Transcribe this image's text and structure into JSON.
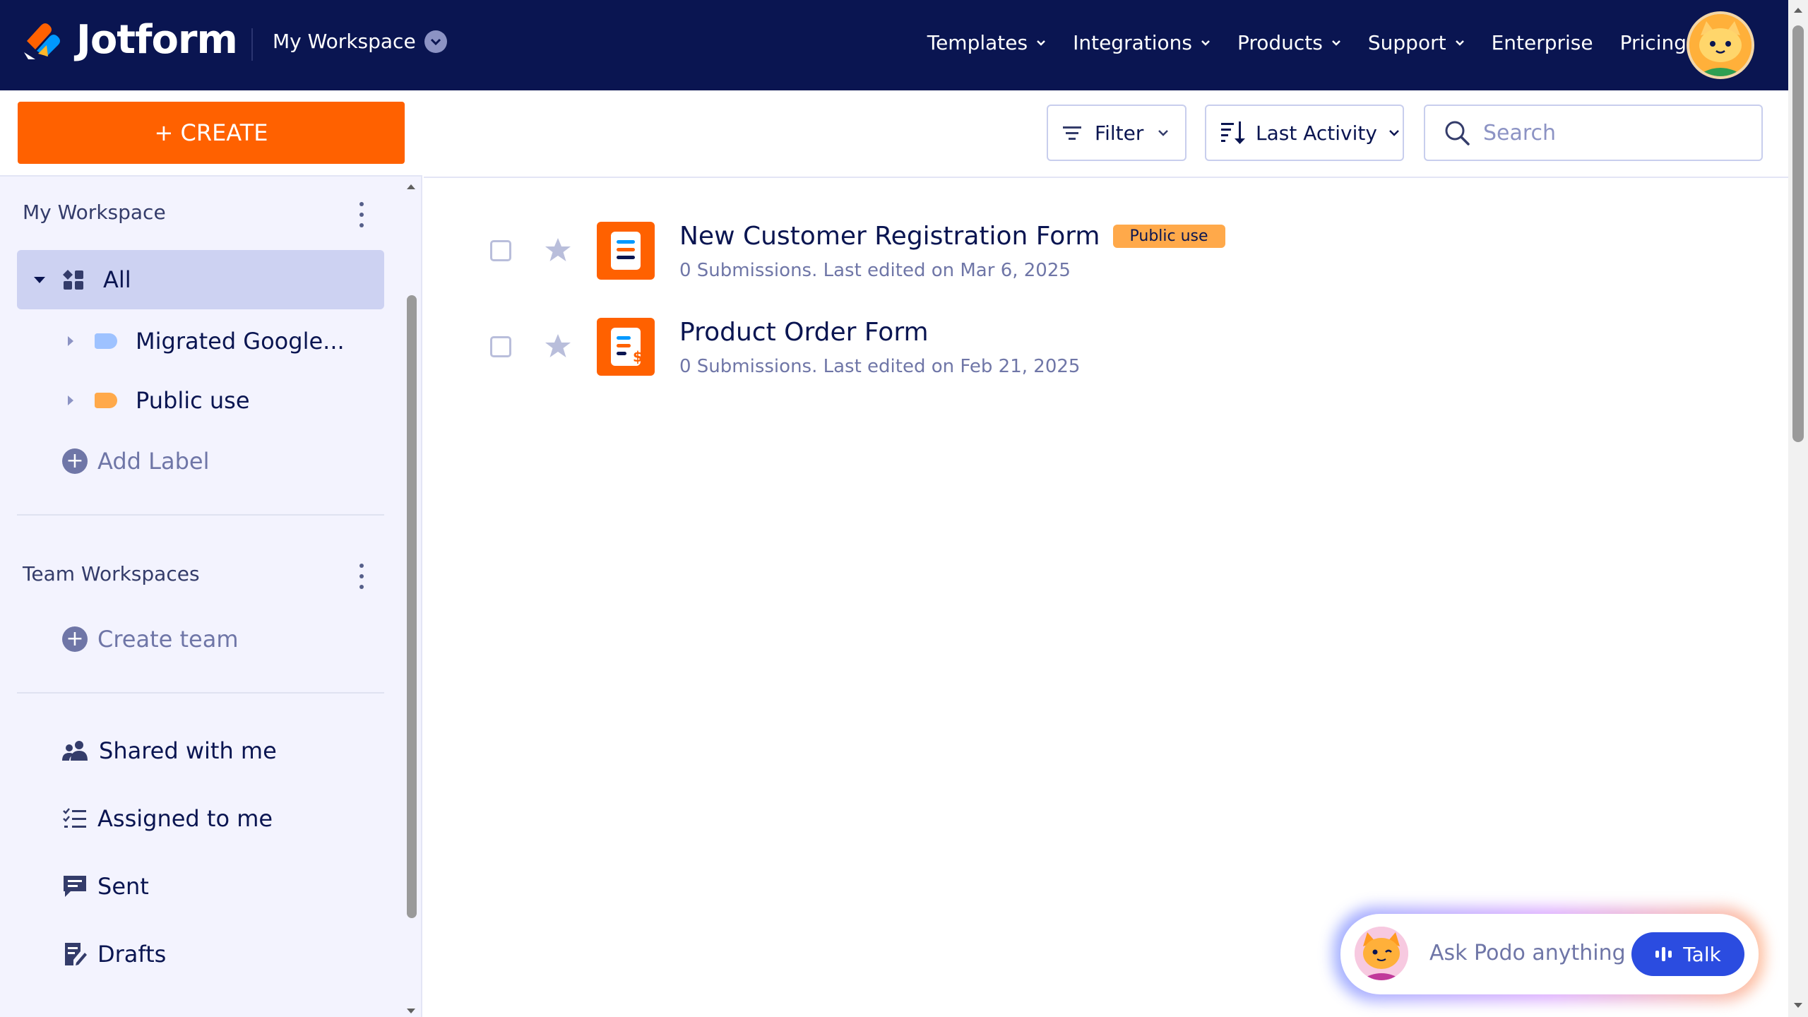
{
  "brand": {
    "name": "Jotform"
  },
  "header": {
    "workspace_label": "My Workspace",
    "nav": [
      "Templates",
      "Integrations",
      "Products",
      "Support",
      "Enterprise",
      "Pricing"
    ]
  },
  "sidebar": {
    "create_label": "+ CREATE",
    "my_workspace_title": "My Workspace",
    "all_label": "All",
    "labels": [
      {
        "name": "Migrated Google...",
        "color": "#9ec2ff"
      },
      {
        "name": "Public use",
        "color": "#ffa94a"
      }
    ],
    "add_label": "Add Label",
    "team_title": "Team Workspaces",
    "create_team": "Create team",
    "links": [
      "Shared with me",
      "Assigned to me",
      "Sent",
      "Drafts"
    ]
  },
  "toolbar": {
    "filter_label": "Filter",
    "sort_label": "Last Activity",
    "search_placeholder": "Search"
  },
  "forms": [
    {
      "title": "New Customer Registration Form",
      "badge": "Public use",
      "meta": "0 Submissions. Last edited on Mar 6, 2025"
    },
    {
      "title": "Product Order Form",
      "badge": "",
      "meta": "0 Submissions. Last edited on Feb 21, 2025"
    }
  ],
  "podo": {
    "placeholder": "Ask Podo anything",
    "talk_label": "Talk"
  },
  "colors": {
    "nav_bg": "#0a1551",
    "create": "#ff6100",
    "accent": "#2b4ce0"
  }
}
